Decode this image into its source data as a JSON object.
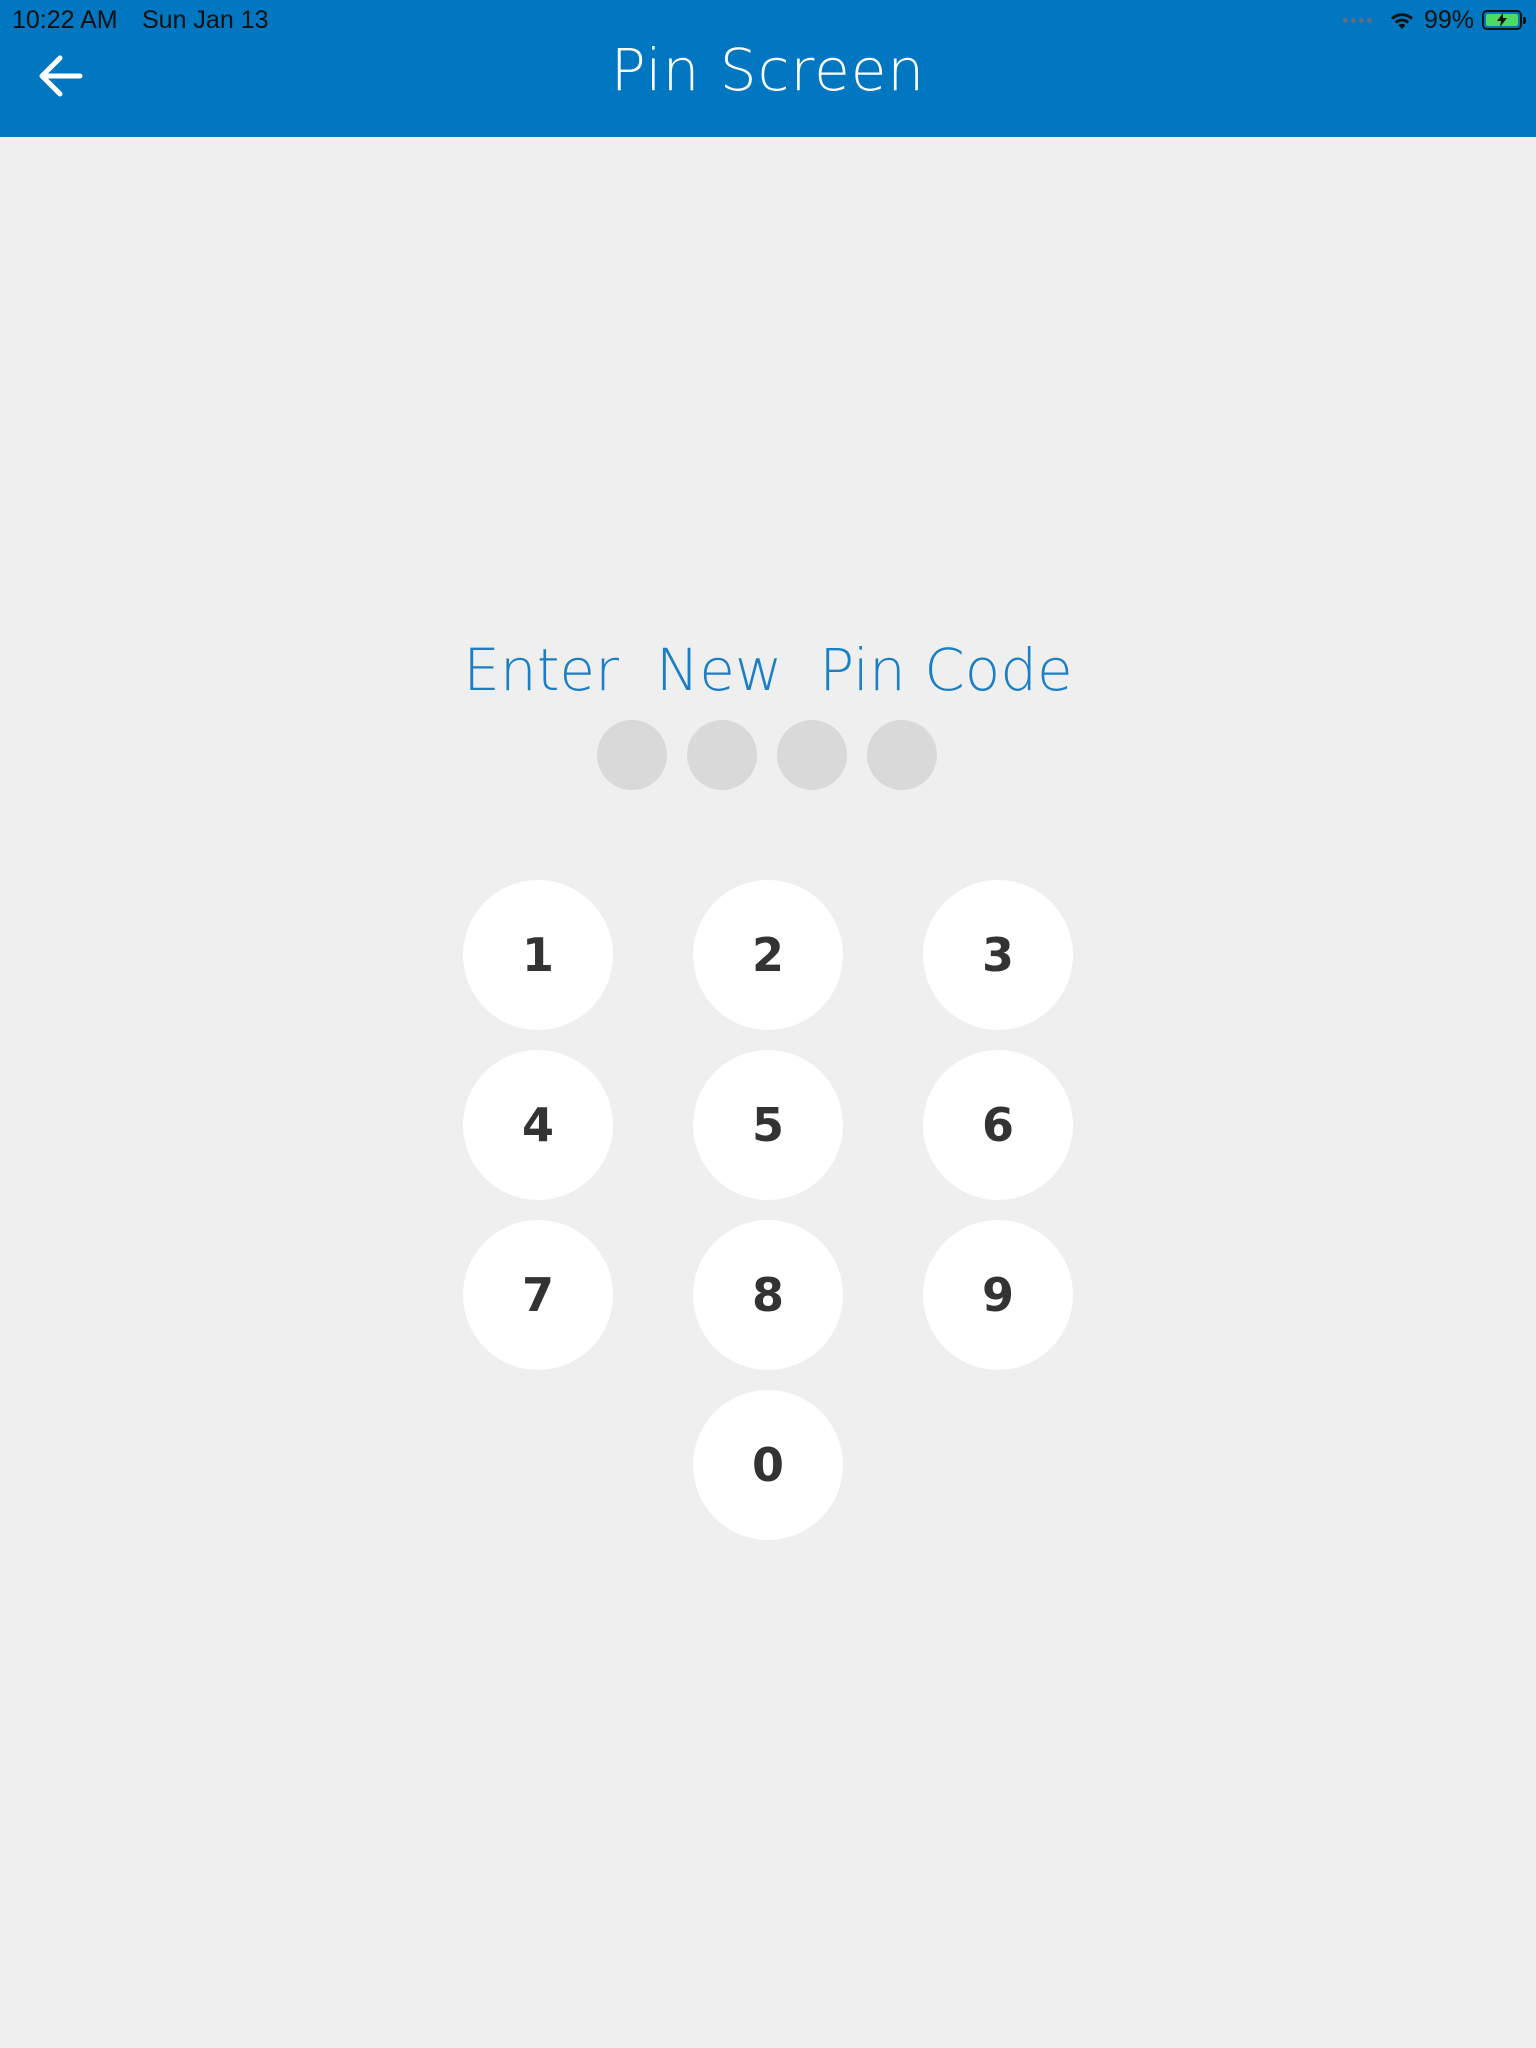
{
  "status_bar": {
    "time": "10:22 AM",
    "date": "Sun Jan 13",
    "battery_percent": "99%",
    "battery_level": 0.99,
    "wifi_icon": "wifi-icon",
    "charging": true
  },
  "header": {
    "title": "Pin Screen",
    "back_icon": "arrow-left-icon",
    "background_color": "#0077c0"
  },
  "pin": {
    "prompt": "Enter  New  Pin Code",
    "length": 4,
    "filled": 0
  },
  "keypad": {
    "keys": [
      "1",
      "2",
      "3",
      "4",
      "5",
      "6",
      "7",
      "8",
      "9",
      "0"
    ]
  },
  "colors": {
    "accent": "#0077c0",
    "prompt_text": "#1a7fc4",
    "background": "#efefef",
    "key_background": "#ffffff",
    "key_text": "#333333",
    "pin_dot_empty": "#d9d9d9"
  }
}
